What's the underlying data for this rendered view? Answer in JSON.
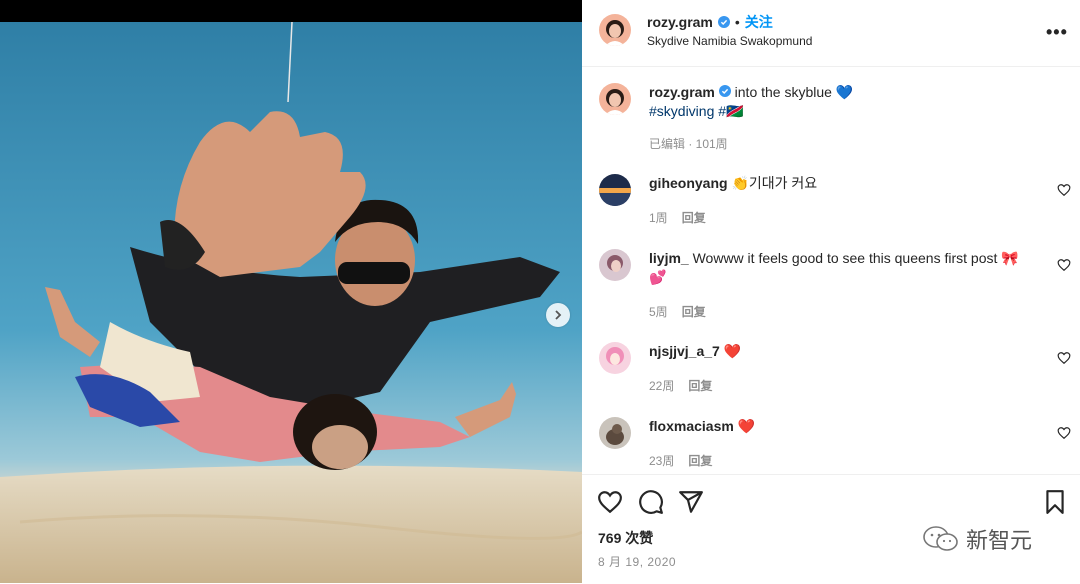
{
  "post": {
    "username": "rozy.gram",
    "follow_label": "关注",
    "dot": "•",
    "location": "Skydive Namibia Swakopmund",
    "more_label": "•••"
  },
  "caption": {
    "username": "rozy.gram",
    "text": "into the skyblue 💙",
    "tag1": "#skydiving",
    "tag2": "#🇳🇦",
    "meta": "已编辑 · 101周"
  },
  "comments": [
    {
      "username": "giheonyang",
      "text": "👏기대가 커요",
      "time": "1周",
      "reply": "回复"
    },
    {
      "username": "liyjm_",
      "text": "Wowww it feels good to see this queens first post 🎀💕",
      "time": "5周",
      "reply": "回复"
    },
    {
      "username": "njsjjvj_a_7",
      "text": "❤️",
      "time": "22周",
      "reply": "回复"
    },
    {
      "username": "floxmaciasm",
      "text": "❤️",
      "time": "23周",
      "reply": "回复"
    }
  ],
  "footer": {
    "likes": "769 次赞",
    "date": "8 月 19, 2020",
    "watermark": "新智元"
  },
  "colors": {
    "accent": "#0095f6",
    "verified": "#3897f0",
    "hashtag": "#00376b",
    "muted": "#8e8e8e"
  }
}
